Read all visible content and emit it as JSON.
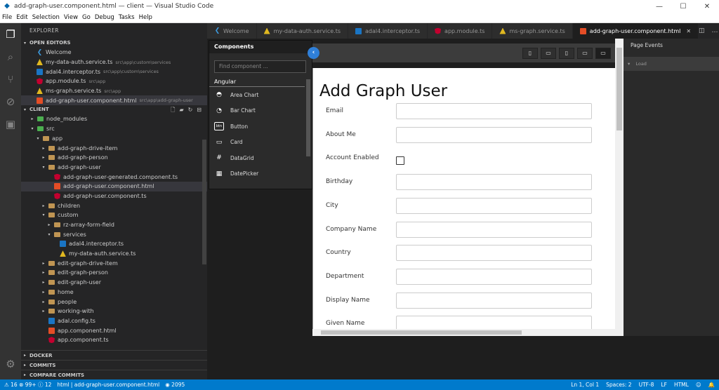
{
  "window": {
    "title": "add-graph-user.component.html — client — Visual Studio Code",
    "minimize": "—",
    "maximize": "☐",
    "close": "✕"
  },
  "menu": [
    "File",
    "Edit",
    "Selection",
    "View",
    "Go",
    "Debug",
    "Tasks",
    "Help"
  ],
  "activity_icons": [
    "explorer-icon",
    "search-icon",
    "source-control-icon",
    "debug-icon",
    "extensions-icon",
    "settings-icon"
  ],
  "sidebar": {
    "title": "EXPLORER",
    "open_editors": {
      "header": "OPEN EDITORS",
      "items": [
        {
          "label": "Welcome",
          "desc": "",
          "icon": "vscode"
        },
        {
          "label": "my-data-auth.service.ts",
          "desc": "src\\app\\custom\\services",
          "icon": "auth"
        },
        {
          "label": "adal4.interceptor.ts",
          "desc": "src\\app\\custom\\services",
          "icon": "ts"
        },
        {
          "label": "app.module.ts",
          "desc": "src\\app",
          "icon": "ng"
        },
        {
          "label": "ms-graph.service.ts",
          "desc": "src\\app",
          "icon": "auth"
        },
        {
          "label": "add-graph-user.component.html",
          "desc": "src\\app\\add-graph-user",
          "icon": "html"
        }
      ]
    },
    "client": {
      "header": "CLIENT",
      "tree": [
        {
          "label": "node_modules",
          "depth": 0,
          "tw": "▸",
          "icon": "folder-green"
        },
        {
          "label": "src",
          "depth": 0,
          "tw": "▾",
          "icon": "folder-green"
        },
        {
          "label": "app",
          "depth": 1,
          "tw": "▾",
          "icon": "folder"
        },
        {
          "label": "add-graph-drive-item",
          "depth": 2,
          "tw": "▸",
          "icon": "folder"
        },
        {
          "label": "add-graph-person",
          "depth": 2,
          "tw": "▸",
          "icon": "folder"
        },
        {
          "label": "add-graph-user",
          "depth": 2,
          "tw": "▾",
          "icon": "folder"
        },
        {
          "label": "add-graph-user-generated.component.ts",
          "depth": 3,
          "tw": "",
          "icon": "ng"
        },
        {
          "label": "add-graph-user.component.html",
          "depth": 3,
          "tw": "",
          "icon": "html"
        },
        {
          "label": "add-graph-user.component.ts",
          "depth": 3,
          "tw": "",
          "icon": "ng"
        },
        {
          "label": "children",
          "depth": 2,
          "tw": "▸",
          "icon": "folder"
        },
        {
          "label": "custom",
          "depth": 2,
          "tw": "▾",
          "icon": "folder"
        },
        {
          "label": "rz-array-form-field",
          "depth": 3,
          "tw": "▸",
          "icon": "folder"
        },
        {
          "label": "services",
          "depth": 3,
          "tw": "▾",
          "icon": "folder"
        },
        {
          "label": "adal4.interceptor.ts",
          "depth": 4,
          "tw": "",
          "icon": "ts"
        },
        {
          "label": "my-data-auth.service.ts",
          "depth": 4,
          "tw": "",
          "icon": "auth"
        },
        {
          "label": "edit-graph-drive-item",
          "depth": 2,
          "tw": "▸",
          "icon": "folder"
        },
        {
          "label": "edit-graph-person",
          "depth": 2,
          "tw": "▸",
          "icon": "folder"
        },
        {
          "label": "edit-graph-user",
          "depth": 2,
          "tw": "▸",
          "icon": "folder"
        },
        {
          "label": "home",
          "depth": 2,
          "tw": "▸",
          "icon": "folder"
        },
        {
          "label": "people",
          "depth": 2,
          "tw": "▸",
          "icon": "folder"
        },
        {
          "label": "working-with",
          "depth": 2,
          "tw": "▸",
          "icon": "folder"
        },
        {
          "label": "adal.config.ts",
          "depth": 2,
          "tw": "",
          "icon": "ts"
        },
        {
          "label": "app.component.html",
          "depth": 2,
          "tw": "",
          "icon": "html"
        },
        {
          "label": "app.component.ts",
          "depth": 2,
          "tw": "",
          "icon": "ng"
        }
      ]
    },
    "bottom_sections": [
      "DOCKER",
      "COMMITS",
      "COMPARE COMMITS"
    ]
  },
  "tabs": [
    {
      "label": "Welcome",
      "icon": "vscode",
      "active": false
    },
    {
      "label": "my-data-auth.service.ts",
      "icon": "auth",
      "active": false
    },
    {
      "label": "adal4.interceptor.ts",
      "icon": "ts",
      "active": false
    },
    {
      "label": "app.module.ts",
      "icon": "ng",
      "active": false
    },
    {
      "label": "ms-graph.service.ts",
      "icon": "auth",
      "active": false
    },
    {
      "label": "add-graph-user.component.html",
      "icon": "html",
      "active": true
    }
  ],
  "components_panel": {
    "title": "Components",
    "search_placeholder": "Find component ...",
    "category": "Angular",
    "items": [
      {
        "label": "Area Chart",
        "icon": "◓"
      },
      {
        "label": "Bar Chart",
        "icon": "◔"
      },
      {
        "label": "Button",
        "icon": "btn"
      },
      {
        "label": "Card",
        "icon": "▭"
      },
      {
        "label": "DataGrid",
        "icon": "#"
      },
      {
        "label": "DatePicker",
        "icon": "▦"
      }
    ]
  },
  "preview": {
    "title": "Add Graph User",
    "fields": [
      {
        "label": "Email",
        "type": "text"
      },
      {
        "label": "About Me",
        "type": "text"
      },
      {
        "label": "Account Enabled",
        "type": "checkbox"
      },
      {
        "label": "Birthday",
        "type": "text"
      },
      {
        "label": "City",
        "type": "text"
      },
      {
        "label": "Company Name",
        "type": "text"
      },
      {
        "label": "Country",
        "type": "text"
      },
      {
        "label": "Department",
        "type": "text"
      },
      {
        "label": "Display Name",
        "type": "text"
      },
      {
        "label": "Given Name",
        "type": "text"
      }
    ]
  },
  "events_panel": {
    "title": "Page Events",
    "items": [
      "Load"
    ]
  },
  "statusbar": {
    "errors": "16",
    "warnings": "99+",
    "infos": "12",
    "branch": "html",
    "file": "html | add-graph-user.component.html",
    "lines": "2095",
    "position": "Ln 1, Col 1",
    "spaces": "Spaces: 2",
    "encoding": "UTF-8",
    "eol": "LF",
    "language": "HTML"
  }
}
